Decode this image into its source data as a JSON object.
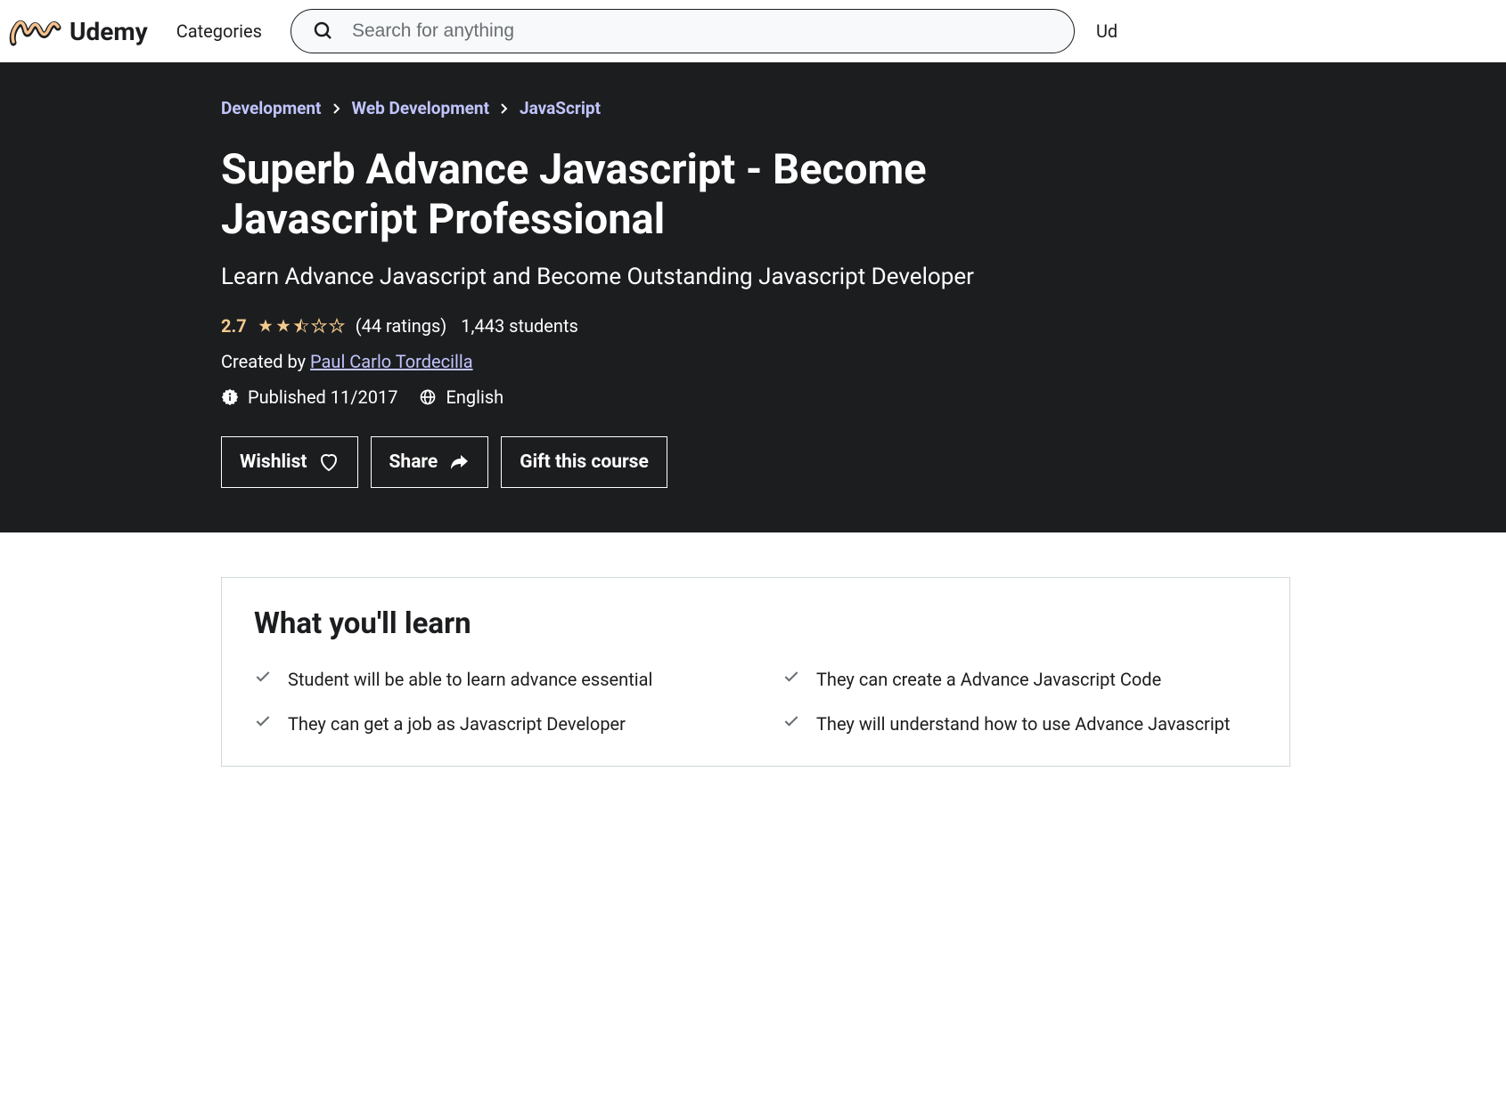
{
  "header": {
    "logo_text": "Udemy",
    "categories": "Categories",
    "search_placeholder": "Search for anything",
    "right_text": "Ud"
  },
  "breadcrumb": [
    "Development",
    "Web Development",
    "JavaScript"
  ],
  "course": {
    "title": "Superb Advance Javascript - Become Javascript Professional",
    "subtitle": "Learn Advance Javascript and Become Outstanding Javascript Developer",
    "rating_value": "2.7",
    "rating_count": "(44 ratings)",
    "students": "1,443 students",
    "created_by_prefix": "Created by ",
    "author": "Paul Carlo Tordecilla",
    "published": "Published 11/2017",
    "language": "English"
  },
  "actions": {
    "wishlist": "Wishlist",
    "share": "Share",
    "gift": "Gift this course"
  },
  "learn": {
    "title": "What you'll learn",
    "items": [
      "Student will be able to learn advance essential",
      "They can create a Advance Javascript Code",
      "They can get a job as Javascript Developer",
      "They will understand how to use Advance Javascript"
    ]
  }
}
